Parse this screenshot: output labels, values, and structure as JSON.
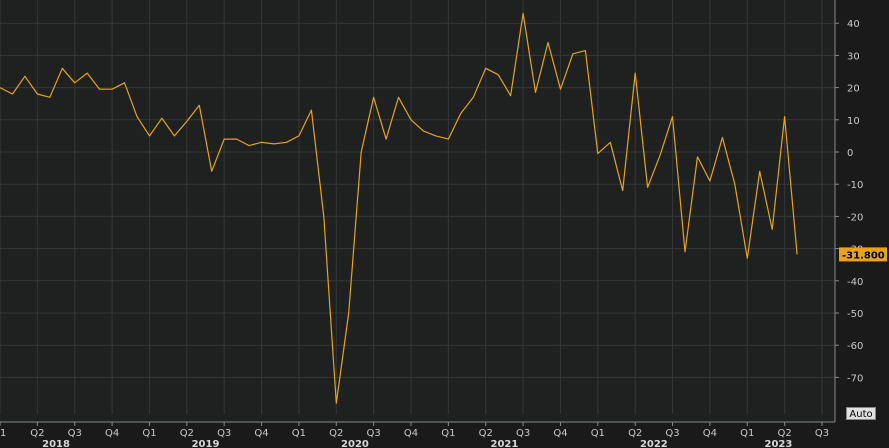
{
  "chart_data": {
    "type": "line",
    "title": "",
    "xlabel": "",
    "ylabel": "",
    "ylim": [
      -80,
      45
    ],
    "y_ticks": [
      40,
      30,
      20,
      10,
      0,
      -10,
      -20,
      -30,
      -40,
      -50,
      -60,
      -70
    ],
    "y_tick_labels": [
      "40",
      "30",
      "20",
      "10",
      "0",
      "-10",
      "-20",
      "-30",
      "-40",
      "-50",
      "-60",
      "-70"
    ],
    "grid": true,
    "line_color": "#e8a317",
    "last_value": -31.8,
    "last_value_label": "-31.800",
    "x_quarter_ticks": [
      {
        "label": "1",
        "t": 0
      },
      {
        "label": "Q2",
        "t": 3
      },
      {
        "label": "Q3",
        "t": 6
      },
      {
        "label": "Q4",
        "t": 9
      },
      {
        "label": "Q1",
        "t": 12
      },
      {
        "label": "Q2",
        "t": 15
      },
      {
        "label": "Q3",
        "t": 18
      },
      {
        "label": "Q4",
        "t": 21
      },
      {
        "label": "Q1",
        "t": 24
      },
      {
        "label": "Q2",
        "t": 27
      },
      {
        "label": "Q3",
        "t": 30
      },
      {
        "label": "Q4",
        "t": 33
      },
      {
        "label": "Q1",
        "t": 36
      },
      {
        "label": "Q2",
        "t": 39
      },
      {
        "label": "Q3",
        "t": 42
      },
      {
        "label": "Q4",
        "t": 45
      },
      {
        "label": "Q1",
        "t": 48
      },
      {
        "label": "Q2",
        "t": 51
      },
      {
        "label": "Q3",
        "t": 54
      },
      {
        "label": "Q4",
        "t": 57
      },
      {
        "label": "Q1",
        "t": 60
      },
      {
        "label": "Q2",
        "t": 63
      },
      {
        "label": "Q3",
        "t": 66
      }
    ],
    "x_year_labels": [
      {
        "label": "2018",
        "t": 4.5
      },
      {
        "label": "2019",
        "t": 16.5
      },
      {
        "label": "2020",
        "t": 28.5
      },
      {
        "label": "2021",
        "t": 40.5
      },
      {
        "label": "2022",
        "t": 52.5
      },
      {
        "label": "2023",
        "t": 62.5
      }
    ],
    "x_range": [
      0,
      66
    ],
    "values": [
      20,
      18,
      23.5,
      18,
      17,
      26,
      21.5,
      24.5,
      19.5,
      19.5,
      21.5,
      11,
      5,
      10.5,
      5,
      9.5,
      14.5,
      -6,
      4,
      4,
      2,
      3,
      2.5,
      3,
      5,
      13,
      -20,
      -78,
      -50,
      0,
      17,
      4,
      17,
      10,
      6.5,
      5,
      4,
      12,
      17,
      26,
      24,
      17.5,
      43,
      18.5,
      34,
      19.5,
      30.5,
      31.5,
      -0.5,
      3,
      -12,
      24.5,
      -11,
      -1,
      11,
      -31,
      -1.5,
      -9,
      4.5,
      -10,
      -33,
      -6,
      -24,
      11,
      -31.8
    ]
  },
  "controls": {
    "auto_label": "Auto"
  }
}
